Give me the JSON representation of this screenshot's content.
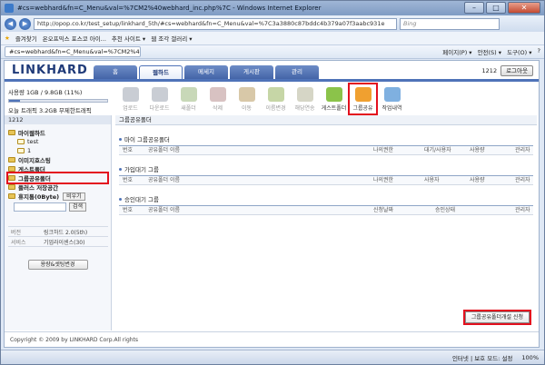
{
  "window": {
    "title": "#cs=webhard&fn=C_Menu&val=%7CM2%40webhard_inc.php%7C - Windows Internet Explorer",
    "min_glyph": "–",
    "max_glyph": "□",
    "close_glyph": "✕"
  },
  "browser": {
    "back_glyph": "◀",
    "forward_glyph": "▶",
    "address": "http://opop.co.kr/test_setup/linkhard_5th/#cs=webhard&fn=C_Menu&val=%7C3a3880c87bddc4b379a07f3aabc931e",
    "search_placeholder": "Bing",
    "favorites_label": "즐겨찾기",
    "fav_items": [
      "온오프믹스 포스코 아이...",
      "추천 사이트 ▾",
      "웹 조각 갤러리 ▾"
    ],
    "tab_label": "#cs=webhard&fn=C_Menu&val=%7CM2%40webhard...",
    "cmd_items": [
      "페이지(P) ▾",
      "안전(S) ▾",
      "도구(O) ▾",
      "?"
    ]
  },
  "app": {
    "logo": "LINKHARD",
    "tabs": [
      "홈",
      "웹하드",
      "메세지",
      "게시판",
      "관리"
    ],
    "active_tab_index": 1,
    "user_id": "1212",
    "logout_label": "로그아웃",
    "usage_text": "사용량 1GB / 9.8GB (11%)",
    "usage_fraction": 0.11,
    "traffic_text": "오늘 트래픽 3.2GB 무제한트래픽"
  },
  "toolbar": [
    {
      "label": "업로드",
      "icon": "upload-icon",
      "enabled": false
    },
    {
      "label": "다운로드",
      "icon": "download-icon",
      "enabled": false
    },
    {
      "label": "새폴더",
      "icon": "new-folder-icon",
      "enabled": false
    },
    {
      "label": "삭제",
      "icon": "delete-icon",
      "enabled": false
    },
    {
      "label": "이동",
      "icon": "move-icon",
      "enabled": false
    },
    {
      "label": "이름변경",
      "icon": "rename-icon",
      "enabled": false
    },
    {
      "label": "해당연송",
      "icon": "transfer-icon",
      "enabled": false
    },
    {
      "label": "게스트폴더",
      "icon": "guest-folder-icon",
      "enabled": true
    },
    {
      "label": "그룹공유",
      "icon": "group-share-icon",
      "enabled": true,
      "highlight": true
    },
    {
      "label": "작업내역",
      "icon": "history-icon",
      "enabled": true
    }
  ],
  "sidebar": {
    "head": "1212",
    "tree": [
      {
        "label": "마이웹하드",
        "level": 0,
        "bold": true
      },
      {
        "label": "test",
        "level": 1,
        "bold": false
      },
      {
        "label": "1",
        "level": 1,
        "bold": false
      },
      {
        "label": "이미지호스팅",
        "level": 0,
        "bold": true
      },
      {
        "label": "게스트폴더",
        "level": 0,
        "bold": true
      },
      {
        "label": "그룹공유폴더",
        "level": 0,
        "bold": true,
        "highlight": true
      },
      {
        "label": "플러스 저장공간",
        "level": 0,
        "bold": true
      },
      {
        "label": "휴지통(0Byte)",
        "level": 0,
        "bold": true
      }
    ],
    "empty_trash_label": "비우기",
    "search_button": "검색",
    "info": [
      {
        "key": "버전",
        "value": "링크하드 2.0(5th)"
      },
      {
        "key": "서비스",
        "value": "기업라이센스(30)"
      }
    ],
    "settings_button": "용량&셋팅변경"
  },
  "main": {
    "head": "그룹공유폴더",
    "sections": [
      {
        "title": "마이 그룹공유폴더",
        "columns": [
          "번호",
          "공유폴더 이름",
          "나의권한",
          "대기/사용자",
          "사용량",
          "관리자"
        ]
      },
      {
        "title": "가입대기 그룹",
        "columns": [
          "번호",
          "공유폴더 이름",
          "나의권한",
          "사용자",
          "사용량",
          "관리자"
        ]
      },
      {
        "title": "승인대기 그룹",
        "columns": [
          "번호",
          "공유폴더 이름",
          "신청날짜",
          "승인상태",
          "관리자"
        ]
      }
    ],
    "apply_button": "그룹공유폴더개설 신청"
  },
  "footer": "Copyright © 2009 by LINKHARD Corp.All rights",
  "statusbar": {
    "zone": "인터넷 | 보호 모드: 설정",
    "zoom": "100%"
  }
}
